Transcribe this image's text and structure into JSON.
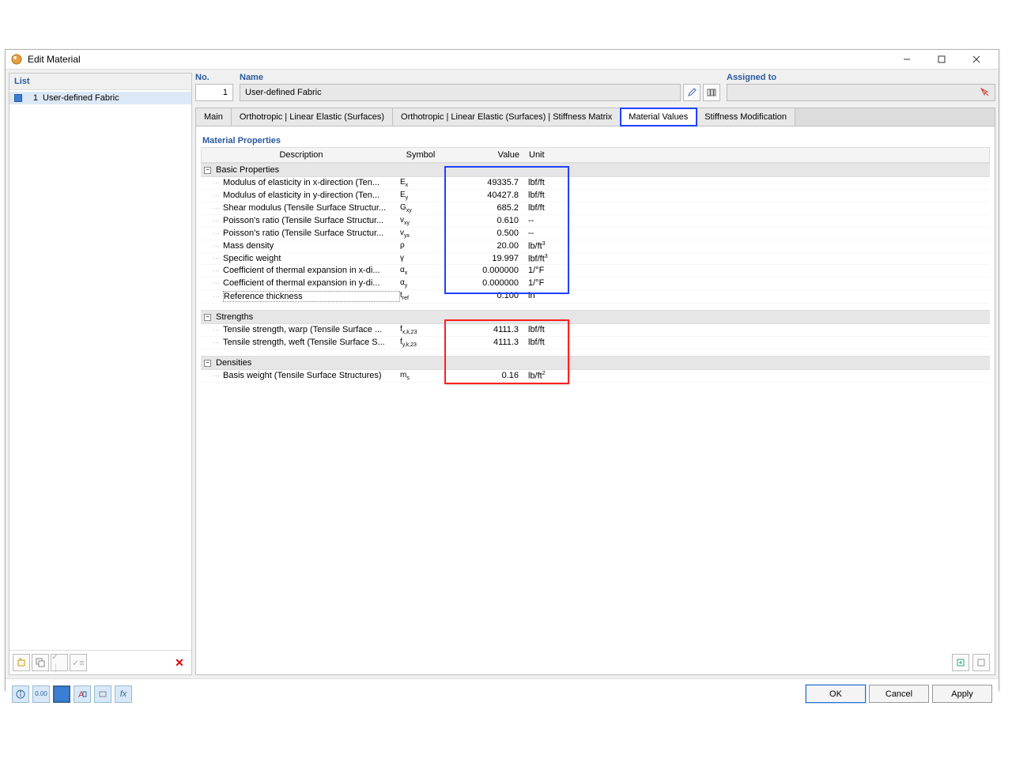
{
  "window": {
    "title": "Edit Material"
  },
  "list": {
    "header": "List",
    "items": [
      {
        "num": "1",
        "label": "User-defined Fabric"
      }
    ]
  },
  "fields": {
    "no_label": "No.",
    "no_value": "1",
    "name_label": "Name",
    "name_value": "User-defined Fabric",
    "assigned_label": "Assigned to",
    "assigned_value": ""
  },
  "tabs": {
    "t0": "Main",
    "t1": "Orthotropic | Linear Elastic (Surfaces)",
    "t2": "Orthotropic | Linear Elastic (Surfaces) | Stiffness Matrix",
    "t3": "Material Values",
    "t4": "Stiffness Modification"
  },
  "section_header": "Material Properties",
  "grid_headers": {
    "desc": "Description",
    "sym": "Symbol",
    "val": "Value",
    "unit": "Unit"
  },
  "groups": {
    "basic": "Basic Properties",
    "strength": "Strengths",
    "dens": "Densities"
  },
  "rows": {
    "basic": [
      {
        "desc": "Modulus of elasticity in x-direction (Ten...",
        "sym": "E<sub>x</sub>",
        "val": "49335.7",
        "unit": "lbf/ft"
      },
      {
        "desc": "Modulus of elasticity in y-direction (Ten...",
        "sym": "E<sub>y</sub>",
        "val": "40427.8",
        "unit": "lbf/ft"
      },
      {
        "desc": "Shear modulus (Tensile Surface Structur...",
        "sym": "G<sub>xy</sub>",
        "val": "685.2",
        "unit": "lbf/ft"
      },
      {
        "desc": "Poisson's ratio (Tensile Surface Structur...",
        "sym": "v<sub>xy</sub>",
        "val": "0.610",
        "unit": "--"
      },
      {
        "desc": "Poisson's ratio (Tensile Surface Structur...",
        "sym": "v<sub>yx</sub>",
        "val": "0.500",
        "unit": "--"
      },
      {
        "desc": "Mass density",
        "sym": "ρ",
        "val": "20.00",
        "unit": "lb/ft<sup>3</sup>"
      },
      {
        "desc": "Specific weight",
        "sym": "γ",
        "val": "19.997",
        "unit": "lbf/ft<sup>3</sup>"
      },
      {
        "desc": "Coefficient of thermal expansion in x-di...",
        "sym": "α<sub>x</sub>",
        "val": "0.000000",
        "unit": "1/°F"
      },
      {
        "desc": "Coefficient of thermal expansion in y-di...",
        "sym": "α<sub>y</sub>",
        "val": "0.000000",
        "unit": "1/°F"
      },
      {
        "desc": "Reference thickness",
        "sym": "t<sub>ref</sub>",
        "val": "0.100",
        "unit": "in",
        "dotted": true
      }
    ],
    "strength": [
      {
        "desc": "Tensile strength, warp (Tensile Surface ...",
        "sym": "f<sub>x,k,23</sub>",
        "val": "4111.3",
        "unit": "lbf/ft"
      },
      {
        "desc": "Tensile strength, weft (Tensile Surface S...",
        "sym": "f<sub>y,k,23</sub>",
        "val": "4111.3",
        "unit": "lbf/ft"
      }
    ],
    "dens": [
      {
        "desc": "Basis weight (Tensile Surface Structures)",
        "sym": "m<sub>s</sub>",
        "val": "0.16",
        "unit": "lb/ft<sup>2</sup>"
      }
    ]
  },
  "buttons": {
    "ok": "OK",
    "cancel": "Cancel",
    "apply": "Apply"
  }
}
